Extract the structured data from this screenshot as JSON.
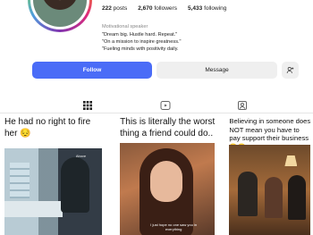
{
  "profile": {
    "stats": [
      {
        "count": "222",
        "label": "posts"
      },
      {
        "count": "2,670",
        "label": "followers"
      },
      {
        "count": "5,433",
        "label": "following"
      }
    ],
    "category": "Motivational speaker",
    "bio_lines": [
      "\"Dream big. Hustle hard. Repeat.\"",
      "\"On a mission to inspire greatness.\"",
      "\"Fueling minds with positivity daily."
    ]
  },
  "actions": {
    "follow_label": "Follow",
    "message_label": "Message",
    "adduser_glyph": "+👤"
  },
  "tabs": [
    {
      "name": "posts",
      "icon": "grid-icon",
      "active": true
    },
    {
      "name": "reels",
      "icon": "reels-icon",
      "active": false
    },
    {
      "name": "tagged",
      "icon": "tagged-icon",
      "active": false
    }
  ],
  "posts": [
    {
      "caption": "He had no right to fire her 😔",
      "overlay": "Above"
    },
    {
      "caption": "This is literally the worst thing a friend could do..",
      "subtitle": "I just hope no one saw you in everything"
    },
    {
      "caption": "Believing in someone does NOT mean you have to pay support their business 😂😂"
    }
  ],
  "colors": {
    "follow_button": "#4a6cf7",
    "secondary_button": "#efefef"
  }
}
